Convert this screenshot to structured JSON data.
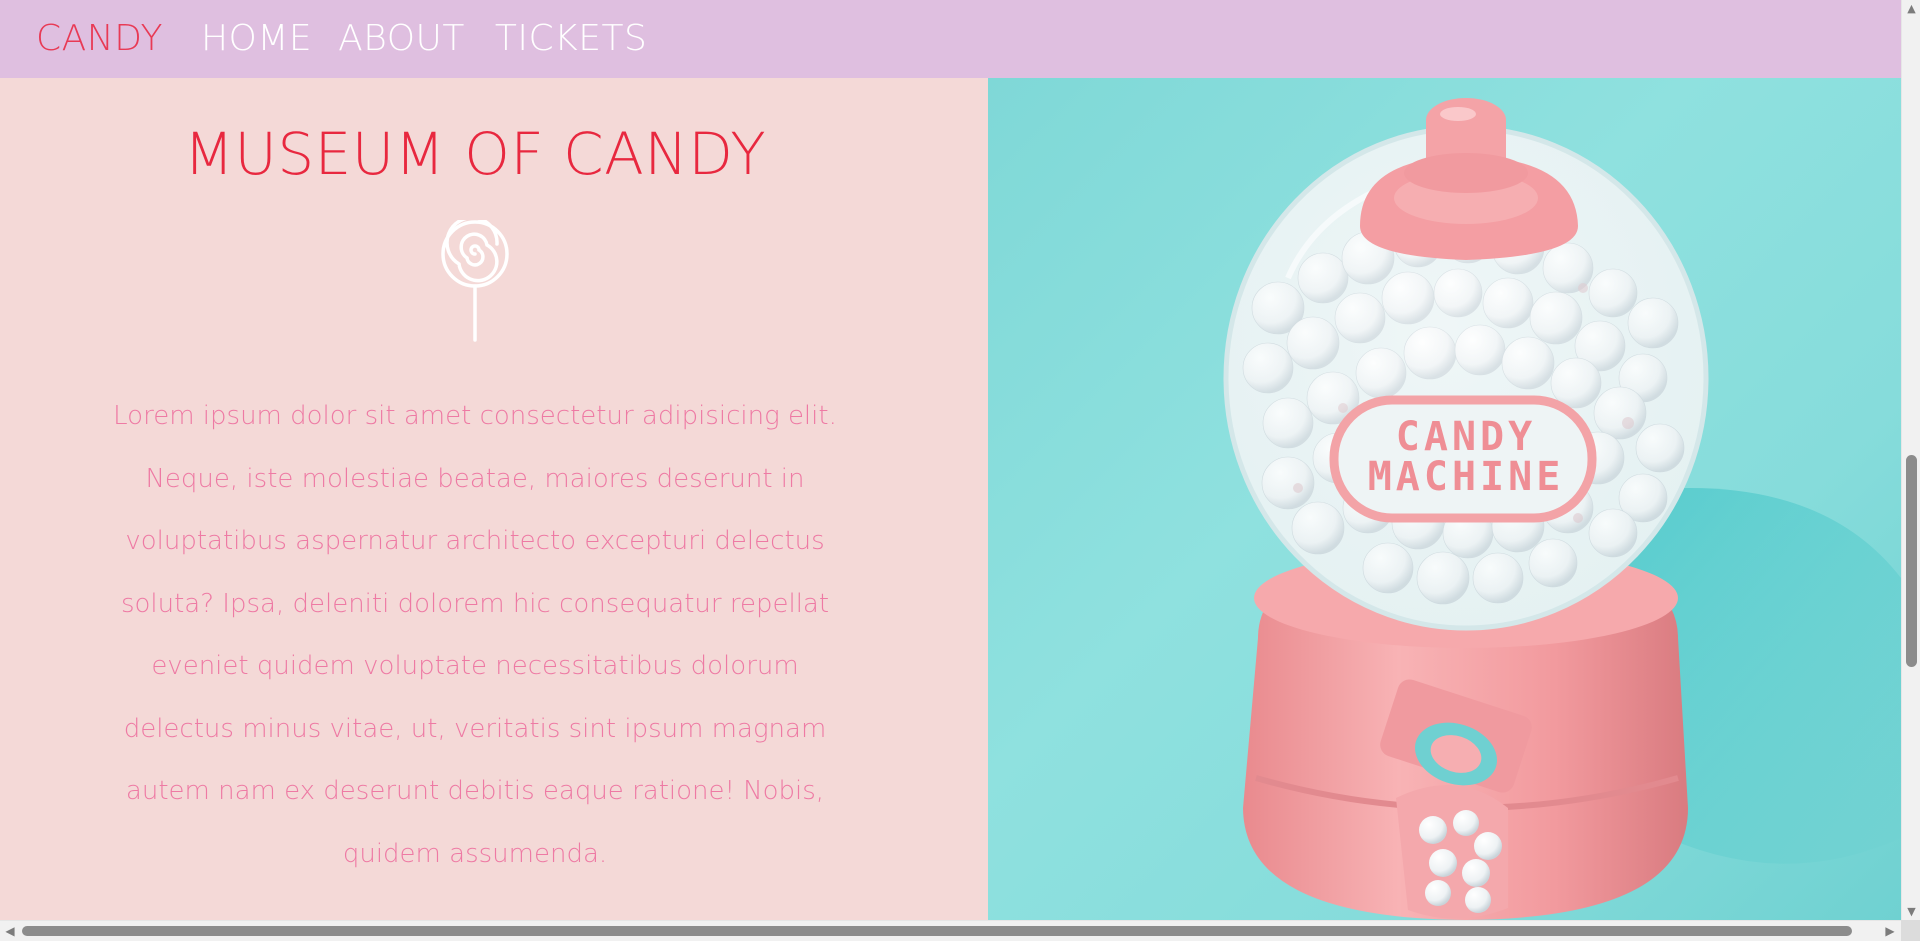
{
  "nav": {
    "brand": "CANDY",
    "links": [
      "HOME",
      "ABOUT",
      "TICKETS"
    ]
  },
  "hero": {
    "title": "MUSEUM OF CANDY",
    "icon": "lollipop-icon",
    "body": "Lorem ipsum dolor sit amet consectetur adipisicing elit. Neque, iste molestiae beatae, maiores deserunt in voluptatibus aspernatur architecto excepturi delectus soluta? Ipsa, deleniti dolorem hic consequatur repellat eveniet quidem voluptate necessitatibus dolorum delectus minus vitae, ut, veritatis sint ipsum magnam autem nam ex deserunt debitis eaque ratione! Nobis, quidem assumenda."
  },
  "image": {
    "label_line1": "CANDY",
    "label_line2": "MACHINE"
  },
  "colors": {
    "nav_bg": "#dfbfe0",
    "brand": "#e83a55",
    "panel_bg": "#f4d9d7",
    "title": "#e8283f",
    "body_text": "#ee7aa4",
    "image_bg": "#86dcdb",
    "machine_pink": "#f4a3a5"
  }
}
